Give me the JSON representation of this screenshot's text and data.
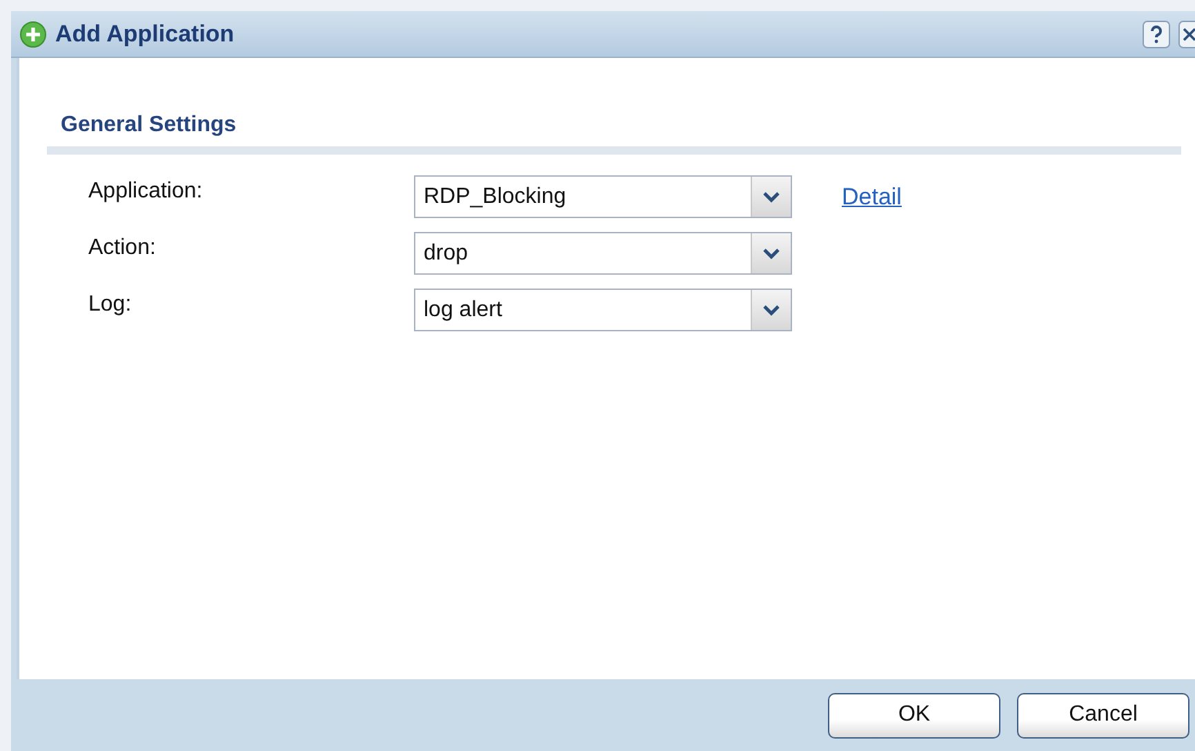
{
  "window": {
    "title": "Add Application"
  },
  "section": {
    "title": "General Settings"
  },
  "fields": [
    {
      "label": "Application:",
      "value": "RDP_Blocking",
      "link": "Detail"
    },
    {
      "label": "Action:",
      "value": "drop"
    },
    {
      "label": "Log:",
      "value": "log alert"
    }
  ],
  "buttons": [
    "OK",
    "Cancel"
  ]
}
